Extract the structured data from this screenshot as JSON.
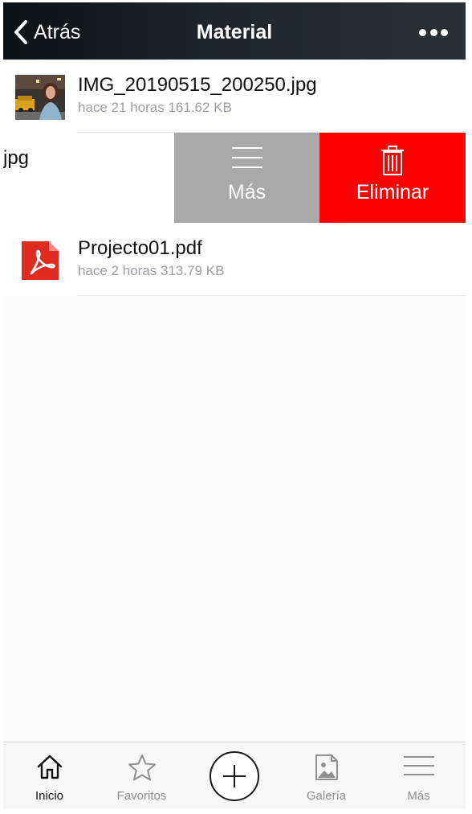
{
  "navbar": {
    "back_label": "Atrás",
    "title": "Material",
    "more_icon": "ellipsis-icon"
  },
  "files": [
    {
      "name": "IMG_20190515_200250.jpg",
      "meta": "hace 21 horas 161.62 KB",
      "icon": "image-thumbnail"
    },
    {
      "name_partial": "jpg",
      "swiped": true
    },
    {
      "name": "Projecto01.pdf",
      "meta": "hace 2 horas 313.79 KB",
      "icon": "pdf-file-icon"
    }
  ],
  "swipe_actions": {
    "more_label": "Más",
    "delete_label": "Eliminar",
    "more_color": "#a9a9a9",
    "delete_color": "#ff0000"
  },
  "tabbar": {
    "tabs": [
      {
        "label": "Inicio",
        "icon": "home-icon",
        "active": true
      },
      {
        "label": "Favoritos",
        "icon": "star-icon",
        "active": false
      },
      {
        "label": "",
        "icon": "plus-circle-icon",
        "active": false
      },
      {
        "label": "Galería",
        "icon": "gallery-icon",
        "active": false
      },
      {
        "label": "Más",
        "icon": "menu-icon",
        "active": false
      }
    ]
  }
}
